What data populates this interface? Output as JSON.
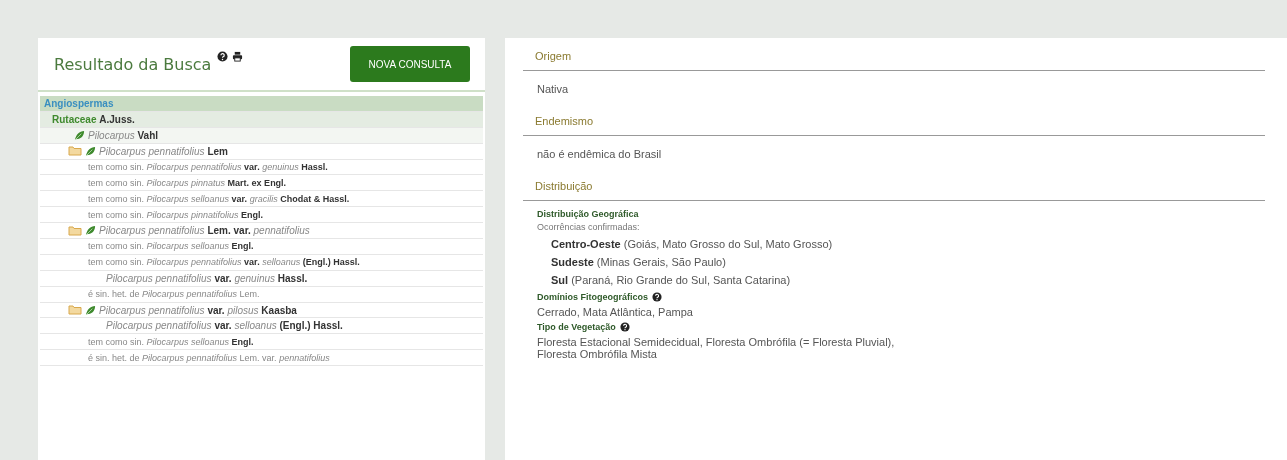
{
  "results": {
    "title": "Resultado da Busca",
    "button": "NOVA CONSULTA",
    "tree": [
      {
        "kind": "group",
        "text": "Angiospermas",
        "children": [
          {
            "kind": "family",
            "text": "Rutaceae **A.Juss.**",
            "children": [
              {
                "kind": "genus",
                "text": "*Pilocarpus* **Vahl**",
                "children": [
                  {
                    "kind": "accepted",
                    "text": "*Pilocarpus pennatifolius* **Lem**",
                    "children": [
                      {
                        "kind": "synonym",
                        "text": "tem como sin. *Pilocarpus pennatifolius* **var.** *genuinus* **Hassl.**"
                      },
                      {
                        "kind": "synonym",
                        "text": "tem como sin. *Pilocarpus pinnatus* **Mart. ex Engl.**"
                      },
                      {
                        "kind": "synonym",
                        "text": "tem como sin. *Pilocarpus selloanus* **var.** *gracilis* **Chodat & Hassl.**"
                      },
                      {
                        "kind": "synonym",
                        "text": "tem como sin. *Pilocarpus pinnatifolius* **Engl.**"
                      }
                    ]
                  },
                  {
                    "kind": "accepted",
                    "text": "*Pilocarpus pennatifolius* **Lem. var.** *pennatifolius*",
                    "children": [
                      {
                        "kind": "synonym",
                        "text": "tem como sin. *Pilocarpus selloanus* **Engl.**"
                      },
                      {
                        "kind": "synonym",
                        "text": "tem como sin. *Pilocarpus pennatifolius* **var.** *selloanus* **(Engl.) Hassl.**",
                        "children": [
                          {
                            "kind": "homotypic",
                            "text": "*Pilocarpus pennatifolius* **var.** *genuinus* **Hassl.**"
                          }
                        ]
                      },
                      {
                        "kind": "heterotypic",
                        "text": "é sin. het. de *Pilocarpus pennatifolius* Lem."
                      }
                    ]
                  },
                  {
                    "kind": "accepted",
                    "text": "*Pilocarpus pennatifolius* **var.** *pilosus* **Kaasba**",
                    "children": [
                      {
                        "kind": "homotypic",
                        "text": "*Pilocarpus pennatifolius* **var.** *selloanus* **(Engl.) Hassl.**"
                      },
                      {
                        "kind": "synonym",
                        "text": "tem como sin. *Pilocarpus selloanus* **Engl.**"
                      },
                      {
                        "kind": "heterotypic",
                        "text": "é sin. het. de *Pilocarpus pennatifolius* Lem. var. *pennatifolius*"
                      }
                    ]
                  }
                ]
              }
            ]
          }
        ]
      }
    ]
  },
  "details": {
    "sections": [
      {
        "kind": "text",
        "title": "Origem",
        "value": "Nativa"
      },
      {
        "kind": "text",
        "title": "Endemismo",
        "value": "não é endêmica do Brasil"
      },
      {
        "kind": "distribution",
        "title": "Distribuição",
        "geographic": {
          "title": "Distribuição Geográfica",
          "subtitle": "Ocorrências confirmadas:",
          "regions": [
            {
              "name": "Centro-Oeste",
              "states": "(Goiás, Mato Grosso do Sul, Mato Grosso)"
            },
            {
              "name": "Sudeste",
              "states": "(Minas Gerais, São Paulo)"
            },
            {
              "name": "Sul",
              "states": "(Paraná, Rio Grande do Sul, Santa Catarina)"
            }
          ]
        },
        "fields": [
          {
            "title": "Domínios Fitogeográficos",
            "value": "Cerrado, Mata Atlântica, Pampa"
          },
          {
            "title": "Tipo de Vegetação",
            "value": "Floresta Estacional Semidecidual, Floresta Ombrófila (= Floresta Pluvial), Floresta Ombrófila Mista"
          }
        ]
      }
    ]
  }
}
